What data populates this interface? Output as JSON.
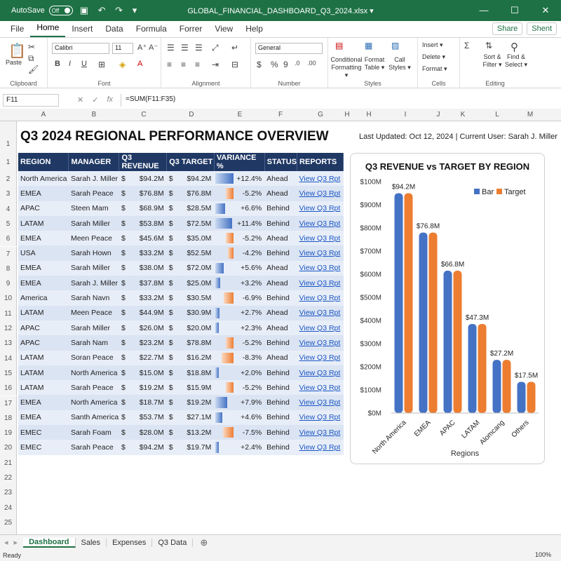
{
  "window": {
    "autosave_label": "AutoSave",
    "autosave_state": "Off",
    "title": "GLOBAL_FINANCIAL_DASHBOARD_Q3_2024.xlsx ▾"
  },
  "ribbon_tabs": [
    "File",
    "Home",
    "Insert",
    "Data",
    "Formula",
    "Forrer",
    "View",
    "Help"
  ],
  "share": {
    "share_label": "Share",
    "shent_label": "Shent"
  },
  "ribbon": {
    "clipboard": {
      "paste": "Paste",
      "label": "Clipboard"
    },
    "font": {
      "name": "Calibri",
      "size": "11",
      "label": "Font"
    },
    "alignment": {
      "label": "Alignment"
    },
    "number": {
      "format": "General",
      "label": "Number"
    },
    "styles": {
      "cond": "Conditional Formatting ▾",
      "fmt": "Format Table ▾",
      "cell": "Call Styles ▾",
      "label": "Styles"
    },
    "cells": {
      "insert": "Insert ▾",
      "delete": "Delete ▾",
      "format": "Format ▾",
      "label": "Cells"
    },
    "editing": {
      "sort": "Sort & Filter ▾",
      "find": "Find & Select ▾",
      "label": "Editing"
    }
  },
  "formula_bar": {
    "cell": "F11",
    "formula": "=SUM(F11:F35)"
  },
  "columns": [
    "A",
    "B",
    "C",
    "D",
    "E",
    "F",
    "G",
    "H",
    "H",
    "I",
    "J",
    "K",
    "L",
    "M"
  ],
  "sheet": {
    "title": "Q3 2024 REGIONAL PERFORMANCE OVERVIEW",
    "updated": "Last Updated: Oct 12, 2024  |  Current User: Sarah J. Miller",
    "headers": [
      "REGION",
      "MANAGER",
      "Q3 REVENUE",
      "Q3 TARGET",
      "VARIANCE %",
      "STATUS",
      "REPORTS"
    ],
    "row_numbers": [
      "1",
      "1",
      "2",
      "3",
      "4",
      "5",
      "6",
      "7",
      "8",
      "9",
      "10",
      "11",
      "12",
      "13",
      "14",
      "15",
      "16",
      "17",
      "18",
      "19",
      "20",
      "21",
      "22",
      "23",
      "24",
      "25",
      "26"
    ],
    "rows": [
      {
        "region": "North America",
        "manager": "Sarah J. Miller",
        "rev_sym": "$",
        "rev": "$94.2M",
        "tgt_sym": "$",
        "tgt": "$94.2M",
        "var": "+12.4%",
        "var_num": 12.4,
        "status": "Ahead",
        "report": "View Q3 Rpt"
      },
      {
        "region": "EMEA",
        "manager": "Sarah Peace",
        "rev_sym": "$",
        "rev": "$76.8M",
        "tgt_sym": "$",
        "tgt": "$76.8M",
        "var": "-5.2%",
        "var_num": -5.2,
        "status": "Ahead",
        "report": "View Q3 Rpt"
      },
      {
        "region": "APAC",
        "manager": "Steen Mam",
        "rev_sym": "$",
        "rev": "$68.9M",
        "tgt_sym": "$",
        "tgt": "$28.5M",
        "var": "+6.6%",
        "var_num": 6.6,
        "status": "Behind",
        "report": "View Q3 Rpt"
      },
      {
        "region": "LATAM",
        "manager": "Sarah Miller",
        "rev_sym": "$",
        "rev": "$53.8M",
        "tgt_sym": "$",
        "tgt": "$72.5M",
        "var": "+11.4%",
        "var_num": 11.4,
        "status": "Behind",
        "report": "View Q3 Rpt"
      },
      {
        "region": "EMEA",
        "manager": "Meen Peace",
        "rev_sym": "$",
        "rev": "$45.6M",
        "tgt_sym": "$",
        "tgt": "$35.0M",
        "var": "-5.2%",
        "var_num": -5.2,
        "status": "Ahead",
        "report": "View Q3 Rpt"
      },
      {
        "region": "USA",
        "manager": "Sarah Hown",
        "rev_sym": "$",
        "rev": "$33.2M",
        "tgt_sym": "$",
        "tgt": "$52.5M",
        "var": "-4.2%",
        "var_num": -4.2,
        "status": "Behind",
        "report": "View Q3 Rpt"
      },
      {
        "region": "EMEA",
        "manager": "Sarah Miller",
        "rev_sym": "$",
        "rev": "$38.0M",
        "tgt_sym": "$",
        "tgt": "$72.0M",
        "var": "+5.6%",
        "var_num": 5.6,
        "status": "Ahead",
        "report": "View Q3 Rpt"
      },
      {
        "region": "EMEA",
        "manager": "Sarah J. Miller",
        "rev_sym": "$",
        "rev": "$37.8M",
        "tgt_sym": "$",
        "tgt": "$25.0M",
        "var": "+3.2%",
        "var_num": 3.2,
        "status": "Ahead",
        "report": "View Q3 Rpt"
      },
      {
        "region": "America",
        "manager": "Sarah Navn",
        "rev_sym": "$",
        "rev": "$33.2M",
        "tgt_sym": "$",
        "tgt": "$30.5M",
        "var": "-6.9%",
        "var_num": -6.9,
        "status": "Behind",
        "report": "View Q3 Rpt"
      },
      {
        "region": "LATAM",
        "manager": "Meen Peace",
        "rev_sym": "$",
        "rev": "$44.9M",
        "tgt_sym": "$",
        "tgt": "$30.9M",
        "var": "+2.7%",
        "var_num": 2.7,
        "status": "Ahead",
        "report": "View Q3 Rpt"
      },
      {
        "region": "APAC",
        "manager": "Sarah Miller",
        "rev_sym": "$",
        "rev": "$26.0M",
        "tgt_sym": "$",
        "tgt": "$20.0M",
        "var": "+2.3%",
        "var_num": 2.3,
        "status": "Ahead",
        "report": "View Q3 Rpt"
      },
      {
        "region": "APAC",
        "manager": "Sarah Nam",
        "rev_sym": "$",
        "rev": "$23.2M",
        "tgt_sym": "$",
        "tgt": "$78.8M",
        "var": "-5.2%",
        "var_num": -5.2,
        "status": "Behind",
        "report": "View Q3 Rpt"
      },
      {
        "region": "LATAM",
        "manager": "Soran Peace",
        "rev_sym": "$",
        "rev": "$22.7M",
        "tgt_sym": "$",
        "tgt": "$16.2M",
        "var": "-8.3%",
        "var_num": -8.3,
        "status": "Ahead",
        "report": "View Q3 Rpt"
      },
      {
        "region": "LATAM",
        "manager": "North America",
        "rev_sym": "$",
        "rev": "$15.0M",
        "tgt_sym": "$",
        "tgt": "$18.8M",
        "var": "+2.0%",
        "var_num": 2.0,
        "status": "Behind",
        "report": "View Q3 Rpt"
      },
      {
        "region": "LATAM",
        "manager": "Sarah Peace",
        "rev_sym": "$",
        "rev": "$19.2M",
        "tgt_sym": "$",
        "tgt": "$15.9M",
        "var": "-5.2%",
        "var_num": -5.2,
        "status": "Behind",
        "report": "View Q3 Rpt"
      },
      {
        "region": "EMEA",
        "manager": "North America",
        "rev_sym": "$",
        "rev": "$18.7M",
        "tgt_sym": "$",
        "tgt": "$19.2M",
        "var": "+7.9%",
        "var_num": 7.9,
        "status": "Behind",
        "report": "View Q3 Rpt"
      },
      {
        "region": "EMEA",
        "manager": "Santh America",
        "rev_sym": "$",
        "rev": "$53.7M",
        "tgt_sym": "$",
        "tgt": "$27.1M",
        "var": "+4.6%",
        "var_num": 4.6,
        "status": "Behind",
        "report": "View Q3 Rpt"
      },
      {
        "region": "EMEC",
        "manager": "Sarah Foam",
        "rev_sym": "$",
        "rev": "$28.0M",
        "tgt_sym": "$",
        "tgt": "$13.2M",
        "var": "-7.5%",
        "var_num": -7.5,
        "status": "Behind",
        "report": "View Q3 Rpt"
      },
      {
        "region": "EMEC",
        "manager": "Sarah Peace",
        "rev_sym": "$",
        "rev": "$94.2M",
        "tgt_sym": "$",
        "tgt": "$19.7M",
        "var": "+2.4%",
        "var_num": 2.4,
        "status": "Behind",
        "report": "View Q3 Rpt"
      }
    ]
  },
  "colors": {
    "header_bg": "#1f3864",
    "bar_blue": "#4472c4",
    "bar_orange": "#ed7d31",
    "excel_green": "#1e7145"
  },
  "chart_data": {
    "type": "bar",
    "title": "Q3 REVENUE vs TARGET BY REGION",
    "categories": [
      "North America",
      "EMEA",
      "APAC",
      "LATAM",
      "Alomcang",
      "Others"
    ],
    "series": [
      {
        "name": "Bar",
        "values": [
          950,
          780,
          615,
          385,
          230,
          135
        ]
      },
      {
        "name": "Target",
        "values": [
          950,
          780,
          615,
          385,
          230,
          135
        ]
      }
    ],
    "data_labels": [
      "$94.2M",
      "$76.8M",
      "$66.8M",
      "$47.3M",
      "$27.2M",
      "$17.5M"
    ],
    "yticks": [
      "$0M",
      "$100M",
      "$200M",
      "$300M",
      "$400M",
      "$500M",
      "$600M",
      "$700M",
      "$800M",
      "$900M",
      "$100M"
    ],
    "ylim": [
      0,
      1000
    ],
    "xlabel": "Regions",
    "ylabel": "",
    "legend": "top-right",
    "grid": false
  },
  "sheet_tabs": [
    "Dashboard",
    "Sales",
    "Expenses",
    "Q3 Data"
  ],
  "status": {
    "ready": "Ready",
    "zoom": "100%"
  }
}
